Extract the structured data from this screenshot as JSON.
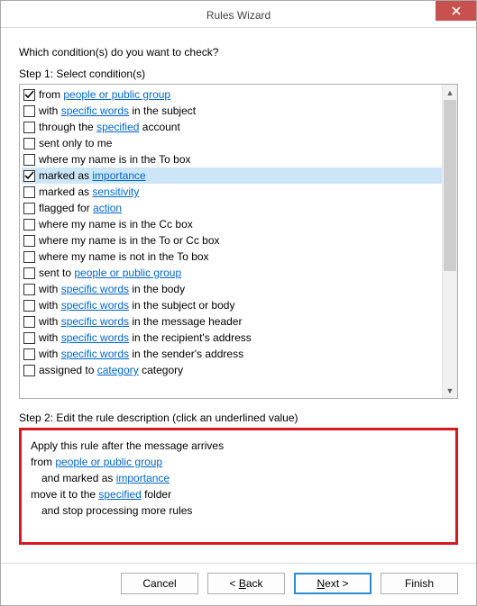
{
  "window": {
    "title": "Rules Wizard"
  },
  "prompt": "Which condition(s) do you want to check?",
  "step1_label": "Step 1: Select condition(s)",
  "step2_label": "Step 2: Edit the rule description (click an underlined value)",
  "conditions": [
    {
      "checked": true,
      "selected": false,
      "pre": "from ",
      "link": "people or public group",
      "post": ""
    },
    {
      "checked": false,
      "selected": false,
      "pre": "with ",
      "link": "specific words",
      "post": " in the subject"
    },
    {
      "checked": false,
      "selected": false,
      "pre": "through the ",
      "link": "specified",
      "post": " account"
    },
    {
      "checked": false,
      "selected": false,
      "pre": "sent only to me",
      "link": "",
      "post": ""
    },
    {
      "checked": false,
      "selected": false,
      "pre": "where my name is in the To box",
      "link": "",
      "post": ""
    },
    {
      "checked": true,
      "selected": true,
      "pre": "marked as ",
      "link": "importance",
      "post": ""
    },
    {
      "checked": false,
      "selected": false,
      "pre": "marked as ",
      "link": "sensitivity",
      "post": ""
    },
    {
      "checked": false,
      "selected": false,
      "pre": "flagged for ",
      "link": "action",
      "post": ""
    },
    {
      "checked": false,
      "selected": false,
      "pre": "where my name is in the Cc box",
      "link": "",
      "post": ""
    },
    {
      "checked": false,
      "selected": false,
      "pre": "where my name is in the To or Cc box",
      "link": "",
      "post": ""
    },
    {
      "checked": false,
      "selected": false,
      "pre": "where my name is not in the To box",
      "link": "",
      "post": ""
    },
    {
      "checked": false,
      "selected": false,
      "pre": "sent to ",
      "link": "people or public group",
      "post": ""
    },
    {
      "checked": false,
      "selected": false,
      "pre": "with ",
      "link": "specific words",
      "post": " in the body"
    },
    {
      "checked": false,
      "selected": false,
      "pre": "with ",
      "link": "specific words",
      "post": " in the subject or body"
    },
    {
      "checked": false,
      "selected": false,
      "pre": "with ",
      "link": "specific words",
      "post": " in the message header"
    },
    {
      "checked": false,
      "selected": false,
      "pre": "with ",
      "link": "specific words",
      "post": " in the recipient's address"
    },
    {
      "checked": false,
      "selected": false,
      "pre": "with ",
      "link": "specific words",
      "post": " in the sender's address"
    },
    {
      "checked": false,
      "selected": false,
      "pre": "assigned to ",
      "link": "category",
      "post": " category"
    }
  ],
  "description": {
    "line1": "Apply this rule after the message arrives",
    "line2_pre": "from ",
    "line2_link": "people or public group",
    "line3_pre": "and marked as ",
    "line3_link": "importance",
    "line4_pre": "move it to the ",
    "line4_link": "specified",
    "line4_post": " folder",
    "line5": "and stop processing more rules"
  },
  "buttons": {
    "cancel": "Cancel",
    "back_lt": "< ",
    "back_label": "Back",
    "next_label": "Next",
    "next_gt": " >",
    "finish": "Finish"
  }
}
